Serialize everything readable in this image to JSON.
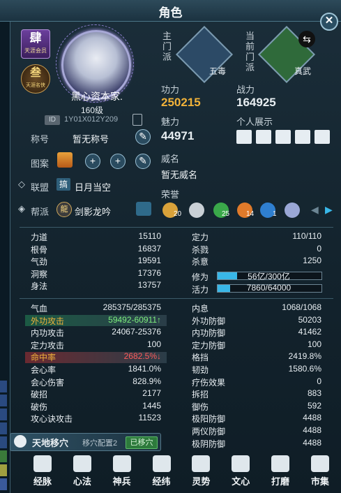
{
  "window": {
    "title": "角色"
  },
  "profile": {
    "badge_tier_big": "肆",
    "badge_tier_small": "天涯会员",
    "badge_round_big": "叁",
    "badge_round_small": "天涯名侠",
    "name": "黑心资本家.",
    "level": "160级",
    "id_tag": "ID",
    "id_value": "1Y01X012Y209"
  },
  "info": {
    "title_label": "称号",
    "title_value": "暂无称号",
    "emblem_label": "图案",
    "alliance_label": "联盟",
    "alliance_badge": "搞",
    "alliance_value": "日月当空",
    "guild_label": "帮派",
    "guild_badge": "龍",
    "guild_value": "剑影龙吟"
  },
  "sects": {
    "main_label": "主门派",
    "main_value": "五毒",
    "current_label": "当前门派",
    "current_value": "真武"
  },
  "power": {
    "gongli_label": "功力",
    "gongli_value": "250215",
    "zhanli_label": "战力",
    "zhanli_value": "164925",
    "meili_label": "魅力",
    "meili_value": "44971",
    "showcase_label": "个人展示"
  },
  "reputation": {
    "label": "威名",
    "value": "暂无威名"
  },
  "honors": {
    "label": "荣誉",
    "items": [
      {
        "name": "honor-1",
        "count": "20"
      },
      {
        "name": "honor-2",
        "count": ""
      },
      {
        "name": "honor-3",
        "count": "25"
      },
      {
        "name": "honor-4",
        "count": "14"
      },
      {
        "name": "honor-5",
        "count": "1"
      },
      {
        "name": "honor-6",
        "count": ""
      }
    ]
  },
  "stats_top_left": [
    {
      "label": "力道",
      "value": "15110"
    },
    {
      "label": "根骨",
      "value": "16837"
    },
    {
      "label": "气劲",
      "value": "19591"
    },
    {
      "label": "洞察",
      "value": "17376"
    },
    {
      "label": "身法",
      "value": "13757"
    }
  ],
  "stats_top_right": [
    {
      "label": "定力",
      "value": "110/110"
    },
    {
      "label": "杀戮",
      "value": "0"
    },
    {
      "label": "杀意",
      "value": "1250"
    }
  ],
  "progress": {
    "xiuwei_label": "修为",
    "xiuwei_text": "56亿/300亿",
    "xiuwei_fraction": 0.19,
    "huoli_label": "活力",
    "huoli_text": "7860/64000",
    "huoli_fraction": 0.12
  },
  "stats_bottom_left": [
    {
      "label": "气血",
      "value": "285375/285375"
    },
    {
      "label": "外功攻击",
      "value": "59492-60911↑"
    },
    {
      "label": "内功攻击",
      "value": "24067-25376"
    },
    {
      "label": "定力攻击",
      "value": "100"
    },
    {
      "label": "命中率",
      "value": "2682.5%↓"
    },
    {
      "label": "会心率",
      "value": "1841.0%"
    },
    {
      "label": "会心伤害",
      "value": "828.9%"
    },
    {
      "label": "破招",
      "value": "2177"
    },
    {
      "label": "破伤",
      "value": "1445"
    },
    {
      "label": "攻心诀攻击",
      "value": "11523"
    }
  ],
  "stats_bottom_right": [
    {
      "label": "内息",
      "value": "1068/1068"
    },
    {
      "label": "外功防御",
      "value": "50203"
    },
    {
      "label": "内功防御",
      "value": "41462"
    },
    {
      "label": "定力防御",
      "value": "100"
    },
    {
      "label": "格挡",
      "value": "2419.8%"
    },
    {
      "label": "韧劲",
      "value": "1580.6%"
    },
    {
      "label": "疗伤效果",
      "value": "0"
    },
    {
      "label": "拆招",
      "value": "883"
    },
    {
      "label": "御伤",
      "value": "592"
    },
    {
      "label": "极阳防御",
      "value": "4488"
    },
    {
      "label": "两仪防御",
      "value": "4488"
    },
    {
      "label": "极阴防御",
      "value": "4488"
    }
  ],
  "meridian": {
    "title": "天地移穴",
    "config": "移穴配置2",
    "status": "已移穴"
  },
  "nav": [
    {
      "name": "nav-jingmai",
      "label": "经脉"
    },
    {
      "name": "nav-xinfa",
      "label": "心法"
    },
    {
      "name": "nav-shenbing",
      "label": "神兵"
    },
    {
      "name": "nav-jingwei",
      "label": "经纬"
    },
    {
      "name": "nav-lingshi",
      "label": "灵势"
    },
    {
      "name": "nav-wenxin",
      "label": "文心"
    },
    {
      "name": "nav-damo",
      "label": "打磨"
    },
    {
      "name": "nav-shiji",
      "label": "市集"
    }
  ],
  "colors": {
    "gold": "#f0b23a",
    "green_stat": "#7ef07e",
    "red_stat": "#ff5b5b",
    "accent_bar": "#39b7e8"
  }
}
